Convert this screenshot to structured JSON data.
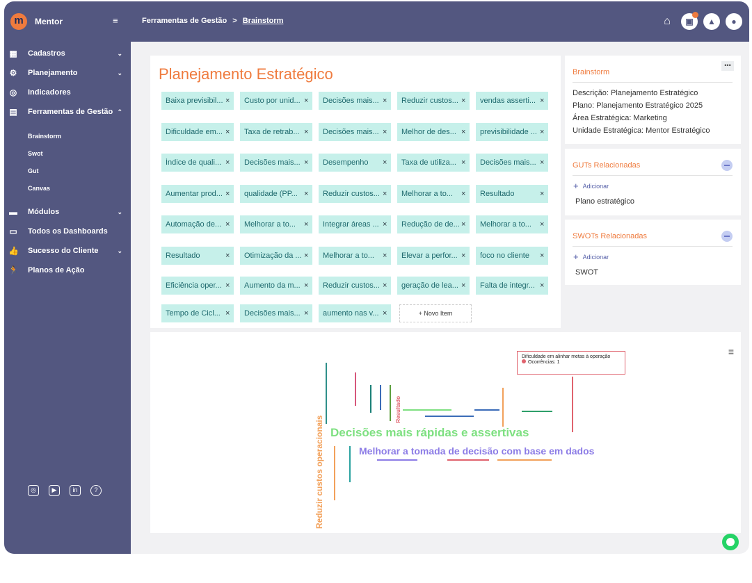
{
  "app": {
    "brand": "Mentor"
  },
  "breadcrumb": {
    "section": "Ferramentas de Gestão",
    "current": "Brainstorm",
    "separator": ">"
  },
  "sidebar": {
    "items": [
      {
        "label": "Cadastros",
        "icon": "grid-icon"
      },
      {
        "label": "Planejamento",
        "icon": "gear-icon"
      },
      {
        "label": "Indicadores",
        "icon": "gauge-icon"
      },
      {
        "label": "Ferramentas de Gestão",
        "icon": "list-icon"
      },
      {
        "label": "Módulos",
        "icon": "server-icon"
      },
      {
        "label": "Todos os Dashboards",
        "icon": "monitor-icon"
      },
      {
        "label": "Sucesso do Cliente",
        "icon": "thumbs-up-icon"
      },
      {
        "label": "Planos de Ação",
        "icon": "running-icon"
      }
    ],
    "subitems": [
      "Brainstorm",
      "Swot",
      "Gut",
      "Canvas"
    ]
  },
  "main": {
    "title": "Planejamento Estratégico",
    "chips": [
      "Baixa previsibil...",
      "Custo por unid...",
      "Decisões mais...",
      "Reduzir custos...",
      "vendas asserti...",
      "Dificuldade em...",
      "Taxa de retrab...",
      "Decisões mais...",
      "Melhor de des...",
      "previsibilidade ...",
      "Índice de quali...",
      "Decisões mais...",
      "Desempenho",
      "Taxa de utiliza...",
      "Decisões mais...",
      "Aumentar prod...",
      "qualidade (PP...",
      "Reduzir custos...",
      "Melhorar a to...",
      "Resultado",
      "Automação de...",
      "Melhorar a to...",
      "Integrar áreas ...",
      "Redução de de...",
      "Melhorar a to...",
      "Resultado",
      "Otimização da ...",
      "Melhorar a to...",
      "Elevar a perfor...",
      "foco no cliente",
      "Eficiência oper...",
      "Aumento da m...",
      "Reduzir custos...",
      "geração de lea...",
      "Falta de integr...",
      "Tempo de Cicl...",
      "Decisões mais...",
      "aumento nas v..."
    ],
    "new_item": "+ Novo Item"
  },
  "info_panel": {
    "title": "Brainstorm",
    "descricao": "Descrição: Planejamento Estratégico",
    "plano": "Plano: Planejamento Estratégico 2025",
    "area": "Área Estratégica: Marketing",
    "unidade": "Unidade Estratégica: Mentor Estratégico"
  },
  "guts_panel": {
    "title": "GUTs Relacionadas",
    "add_label": "Adicionar",
    "item": "Plano estratégico"
  },
  "swots_panel": {
    "title": "SWOTs Relacionadas",
    "add_label": "Adicionar",
    "item": "SWOT"
  },
  "chart_data": {
    "type": "wordcloud",
    "tooltip": {
      "title": "Dificuldade em alinhar metas à operação",
      "label": "Ocorrências: 1"
    },
    "words": [
      {
        "text": "Decisões mais rápidas e assertivas",
        "color": "#7ee081"
      },
      {
        "text": "Melhorar a tomada de decisão com base em dados",
        "color": "#8c7ce6"
      },
      {
        "text": "Reduzir custos operacionais",
        "color": "#f2a15b"
      },
      {
        "text": "Resultado",
        "color": "#e0636e"
      }
    ]
  },
  "colors": {
    "sidebar": "#535780",
    "accent": "#ef7b3e",
    "chip": "#c6f0ea"
  }
}
